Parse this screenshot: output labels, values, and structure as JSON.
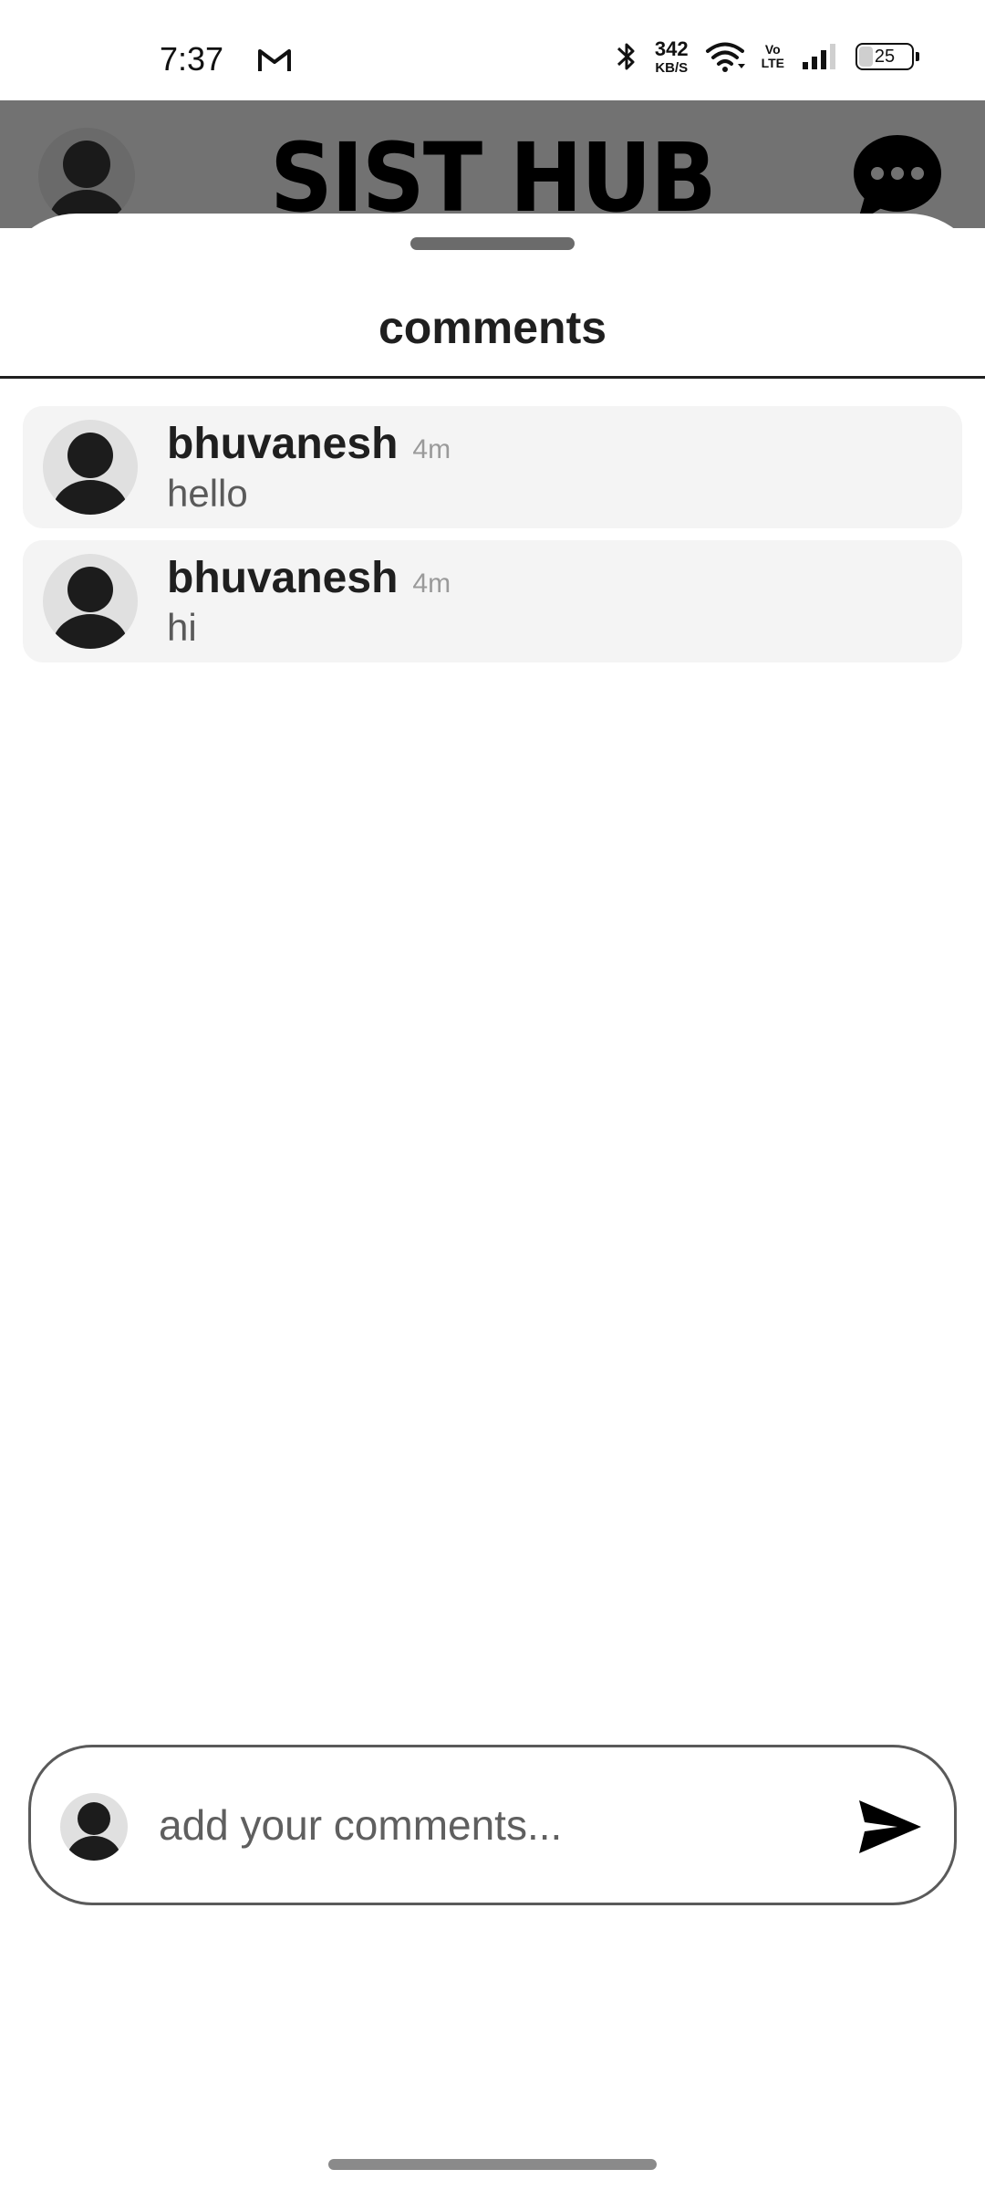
{
  "status_bar": {
    "time": "7:37",
    "notification_icon": "gmail-icon",
    "network_speed_value": "342",
    "network_speed_unit": "KB/S",
    "volte_top": "Vo",
    "volte_bottom": "LTE",
    "battery_level": "25",
    "icons": [
      "bluetooth-icon",
      "wifi-icon",
      "signal-icon",
      "battery-icon"
    ]
  },
  "header": {
    "title": "SIST HUB",
    "left_icon": "profile-avatar-icon",
    "right_icon": "chat-bubble-icon"
  },
  "sheet": {
    "title": "comments"
  },
  "comments": [
    {
      "user": "bhuvanesh",
      "time": "4m",
      "text": "hello",
      "avatar_icon": "user-avatar-icon"
    },
    {
      "user": "bhuvanesh",
      "time": "4m",
      "text": "hi",
      "avatar_icon": "user-avatar-icon"
    }
  ],
  "input": {
    "placeholder": "add your comments...",
    "value": "",
    "send_icon": "send-icon"
  },
  "colors": {
    "header_background": "#727272",
    "sheet_background": "#ffffff",
    "comment_card_background": "#f4f4f4",
    "avatar_background": "#e0e0e0",
    "text_primary": "#1f1f1f",
    "text_muted": "#9a9a9a"
  }
}
